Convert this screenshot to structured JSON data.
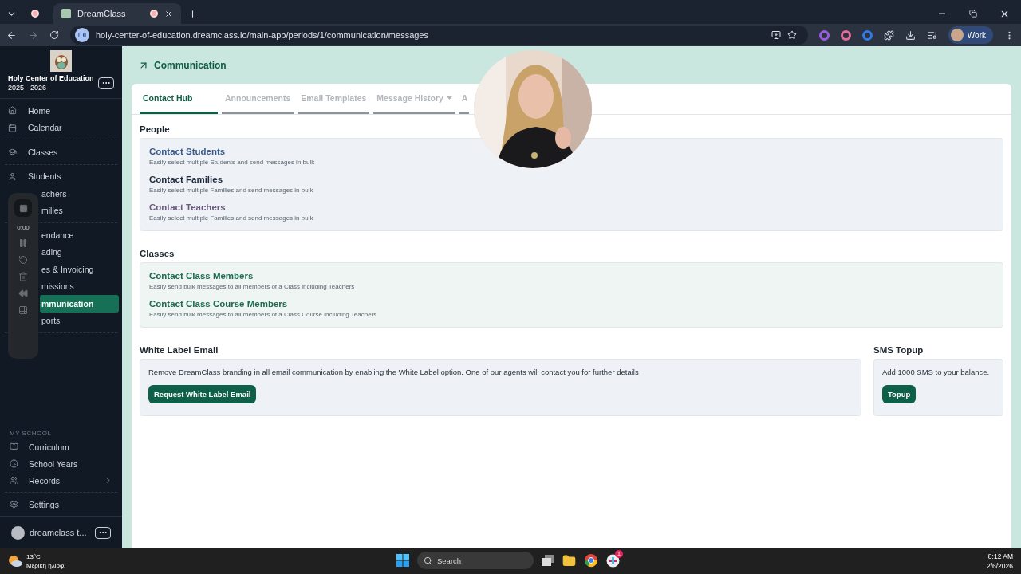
{
  "browser": {
    "tabs": [
      {
        "selected": false,
        "recording": true
      },
      {
        "title": "DreamClass",
        "selected": true,
        "recording": true
      }
    ],
    "url": "holy-center-of-education.dreamclass.io/main-app/periods/1/communication/messages",
    "profile": "Work"
  },
  "school": {
    "name": "Holy Center of Education",
    "period": "2025 - 2026"
  },
  "sidebar": {
    "groups": [
      [
        {
          "label": "Home",
          "selected": false,
          "kind": "full"
        },
        {
          "label": "Calendar",
          "selected": false,
          "kind": "full"
        }
      ],
      [
        {
          "label": "Classes",
          "selected": false,
          "kind": "full"
        }
      ],
      [
        {
          "label": "Students",
          "selected": false,
          "kind": "full"
        },
        {
          "label": "achers",
          "selected": false,
          "kind": "covered"
        },
        {
          "label": "milies",
          "selected": false,
          "kind": "covered"
        }
      ],
      [
        {
          "label": "endance",
          "selected": false,
          "kind": "covered"
        },
        {
          "label": "ading",
          "selected": false,
          "kind": "covered"
        },
        {
          "label": "es & Invoicing",
          "selected": false,
          "kind": "covered"
        },
        {
          "label": "missions",
          "selected": false,
          "kind": "covered"
        },
        {
          "label": "mmunication",
          "selected": true,
          "kind": "covered"
        },
        {
          "label": "ports",
          "selected": false,
          "kind": "covered"
        }
      ]
    ],
    "section_title": "MY SCHOOL",
    "school_items": [
      {
        "label": "Curriculum",
        "kind": "link"
      },
      {
        "label": "School Years",
        "kind": "link"
      },
      {
        "label": "Records",
        "kind": "expand"
      }
    ],
    "settings": "Settings",
    "user": "dreamclass t..."
  },
  "recorder": {
    "time": "0:00"
  },
  "page_title": "Communication",
  "tabs": [
    {
      "label": "Contact Hub",
      "selected": true,
      "dropdown": false
    },
    {
      "label": "Announcements",
      "selected": false,
      "dropdown": false
    },
    {
      "label": "Email Templates",
      "selected": false,
      "dropdown": false
    },
    {
      "label": "Message History",
      "selected": false,
      "dropdown": true
    },
    {
      "label": "A",
      "selected": false,
      "dropdown": false
    }
  ],
  "sections": [
    {
      "title": "People",
      "links": [
        {
          "title": "Contact Students",
          "description": "Easily select multiple Students and send messages in bulk",
          "color": "#3b5a8c"
        },
        {
          "title": "Contact Families",
          "description": "Easily select multiple Families and send messages in bulk",
          "color": "#1c2a3c"
        },
        {
          "title": "Contact Teachers",
          "description": "Easily select multiple Families and send messages in bulk",
          "color": "#6b5b7b"
        }
      ]
    },
    {
      "title": "Classes",
      "links": [
        {
          "title": "Contact Class Members",
          "description": "Easily send bulk messages to all members of a Class including Teachers",
          "color": "#1d6b50"
        },
        {
          "title": "Contact Class Course Members",
          "description": "Easily send bulk messages to all members of a Class Course including Teachers",
          "color": "#1d6b50"
        }
      ]
    }
  ],
  "offers": [
    {
      "title": "White Label Email",
      "text": "Remove DreamClass branding in all email communication by enabling the White Label option. One of our agents will contact you for further details",
      "button": "Request White Label Email",
      "wide": true
    },
    {
      "title": "SMS Topup",
      "text": "Add 1000 SMS to your balance.",
      "button": "Topup",
      "wide": false
    }
  ],
  "taskbar": {
    "temperature": "13°C",
    "weather": "Μερική ηλιοφ.",
    "search": "Search",
    "time": "8:12 AM",
    "date": "2/6/2026",
    "badge": "1"
  }
}
